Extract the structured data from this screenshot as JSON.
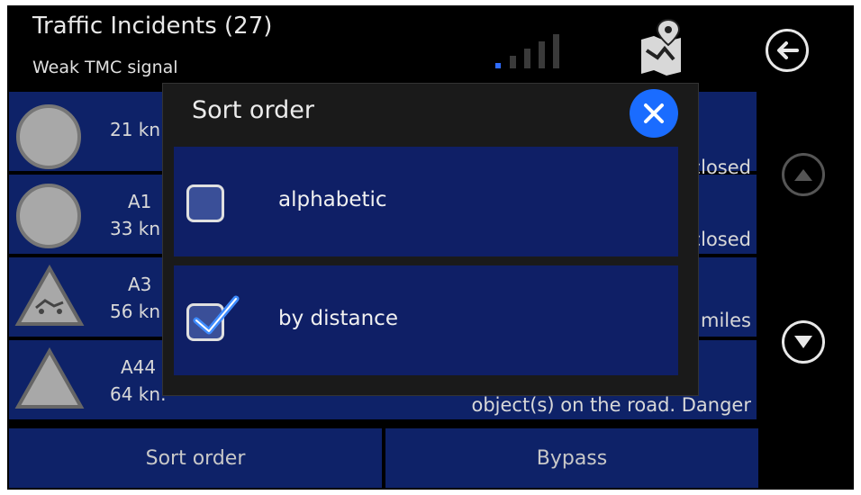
{
  "header": {
    "title": "Traffic Incidents (27)",
    "subtitle": "Weak TMC signal"
  },
  "icons": {
    "signal": "signal-strength-icon",
    "map": "map-route-icon",
    "back": "back-arrow-icon",
    "up": "chevron-up-icon",
    "down": "chevron-down-icon",
    "close": "close-icon",
    "checkbox": "checkbox-icon"
  },
  "incidents": [
    {
      "road": "",
      "distance": "21 kn",
      "info": ""
    },
    {
      "road": "A1",
      "distance": "33 kn",
      "info": "closed"
    },
    {
      "road": "A3",
      "distance": "56 kn",
      "info": "miles"
    },
    {
      "road": "A44",
      "distance": "64 kn.",
      "info": "object(s) on the road. Danger"
    }
  ],
  "bottom_bar": {
    "sort_order_label": "Sort order",
    "bypass_label": "Bypass"
  },
  "dialog": {
    "title": "Sort order",
    "options": [
      {
        "label": "alphabetic",
        "checked": false
      },
      {
        "label": "by distance",
        "checked": true
      }
    ]
  },
  "colors": {
    "row_bg": "#0e2268",
    "option_bg": "#0f1f66",
    "close_button": "#1a6cff",
    "signal_active": "#2f6cff"
  }
}
